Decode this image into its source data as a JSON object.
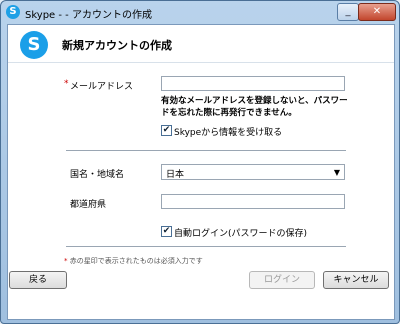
{
  "window": {
    "title": "Skype - - アカウントの作成",
    "close_glyph": "✕",
    "min_glyph": "_"
  },
  "header": {
    "logo_letter": "S",
    "title": "新規アカウントの作成"
  },
  "form": {
    "email_label": "メールアドレス",
    "required_mark": "*",
    "email_note_line1": "有効なメールアドレスを登録しないと、パスワー",
    "email_note_line2": "ドを忘れた際に再発行できません。",
    "info_checkbox_label": "Skypeから情報を受け取る",
    "info_checked": true,
    "country_label": "国名・地域名",
    "country_value": "日本",
    "prefecture_label": "都道府県",
    "prefecture_value": "",
    "auto_login_label": "自動ログイン(パスワードの保存)",
    "auto_login_checked": true,
    "footnote": "赤の星印で表示されたものは必須入力です"
  },
  "buttons": {
    "back": "戻る",
    "login": "ログイン",
    "cancel": "キャンセル"
  },
  "icons": {
    "checked": "✔",
    "dropdown": "▼"
  }
}
